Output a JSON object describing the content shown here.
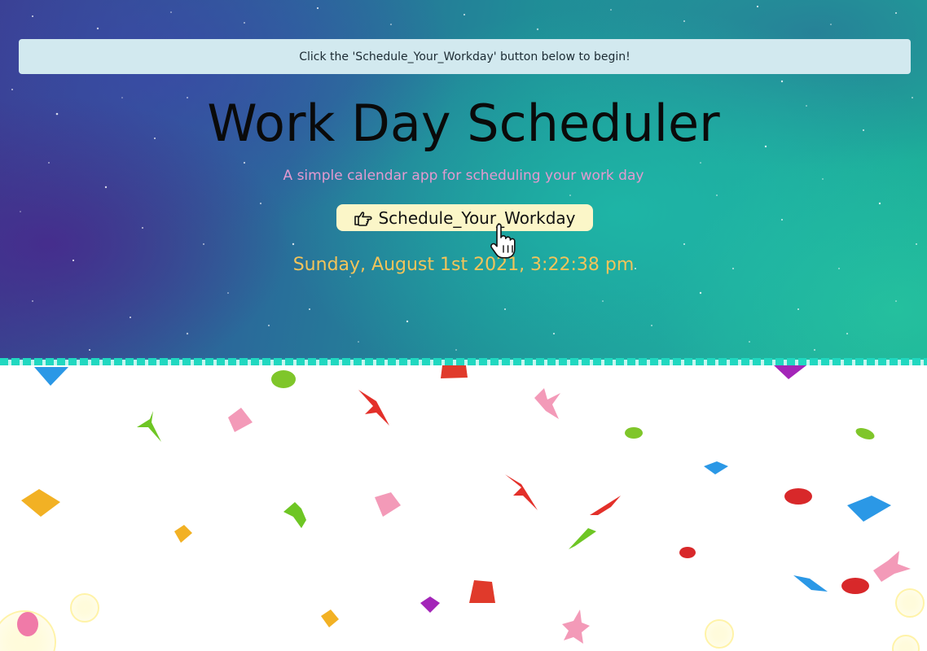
{
  "banner": {
    "text": "Click the 'Schedule_Your_Workday' button below to begin!"
  },
  "header": {
    "title": "Work Day Scheduler",
    "subtitle": "A simple calendar app for scheduling your work day"
  },
  "cta": {
    "icon": "hand-pointing-right-icon",
    "label": "Schedule_Your_Workday"
  },
  "datetime": {
    "text": "Sunday, August 1st 2021, 3:22:38 pm"
  },
  "colors": {
    "banner_bg": "#d2e9ef",
    "subtitle": "#e49ad0",
    "datetime": "#f3c45a",
    "cta_bg": "#fbf6c8",
    "border_dash": "#20d8c0"
  }
}
